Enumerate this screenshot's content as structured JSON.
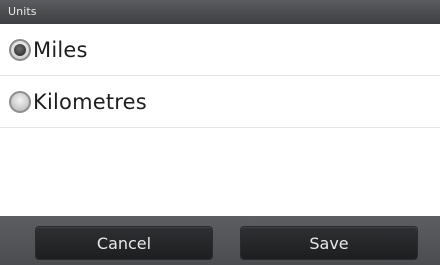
{
  "header": {
    "title": "Units"
  },
  "options": [
    {
      "label": "Miles",
      "selected": true
    },
    {
      "label": "Kilometres",
      "selected": false
    }
  ],
  "footer": {
    "cancel_label": "Cancel",
    "save_label": "Save"
  }
}
